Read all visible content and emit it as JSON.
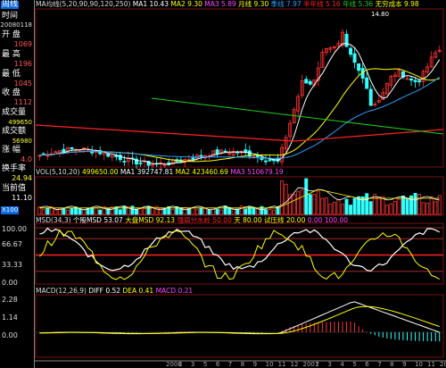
{
  "period_tab": "周线",
  "side": {
    "time_label": "时间",
    "time_value": "20080118",
    "open_label": "开  盘",
    "open_value": "1069",
    "high_label": "最  高",
    "high_value": "1196",
    "low_label": "最  低",
    "low_value": "1045",
    "close_label": "收  盘",
    "close_value": "1112",
    "volume_label": "成交量",
    "volume_value": "499650",
    "amount_label": "成交额",
    "amount_value": "56980",
    "change_label": "涨  幅",
    "change_value": "4.0",
    "turnover_label": "换手率",
    "turnover_value": "24.94",
    "current_label": "当前值",
    "current_value": "11.10"
  },
  "price_header": {
    "ma_name": "MA均线(5,20,90,90,120,250)",
    "ma1": "MA1 10.43",
    "ma2": "MA2 9.30",
    "ma3": "MA3 5.89",
    "month": "月线 9.30",
    "quarter": "季线 7.97",
    "half": "半年线 5.16",
    "year": "年线 5.36",
    "nocost": "无穷成本 9.98",
    "peak": "14.80"
  },
  "vol_header": {
    "name": "VOL(5,10,20)",
    "vol": "499650.00",
    "ma1": "MA1 392747.81",
    "ma2": "MA2 423460.69",
    "ma3": "MA3 510679.19"
  },
  "vol_x100": "X100",
  "msd_header": {
    "name": "MSD(34,3)",
    "a": "个股MSD 53.07",
    "b": "大盘MSD 92.13",
    "c": "强弱分水岭 50.00",
    "d": "天 80.00",
    "e": "试压线 20.00",
    "f": "0.00",
    "g": "100.00"
  },
  "msd_axis": [
    "100.00",
    "66.67",
    "33.33",
    "0.00"
  ],
  "macd_header": {
    "name": "MACD(12,26,9)",
    "diff": "DIFF 0.52",
    "dea": "DEA 0.41",
    "macd": "MACD 0.21"
  },
  "macd_axis": [
    "2.28",
    "1.14",
    "0.00"
  ],
  "x_axis": [
    "2006",
    "2",
    "3",
    "5",
    "6",
    "7",
    "8",
    "9",
    "10",
    "11",
    "12",
    "2007",
    "2",
    "3",
    "4",
    "5",
    "6",
    "7",
    "8",
    "9",
    "10",
    "11",
    "2008"
  ],
  "colors": {
    "up": "#ff3333",
    "down": "#33ffff",
    "ma1": "#ffffff",
    "ma2": "#ffff00",
    "ma3": "#ff44ff",
    "blue": "#2aa0ff",
    "green": "#22cc22",
    "red": "#ff2222"
  }
}
